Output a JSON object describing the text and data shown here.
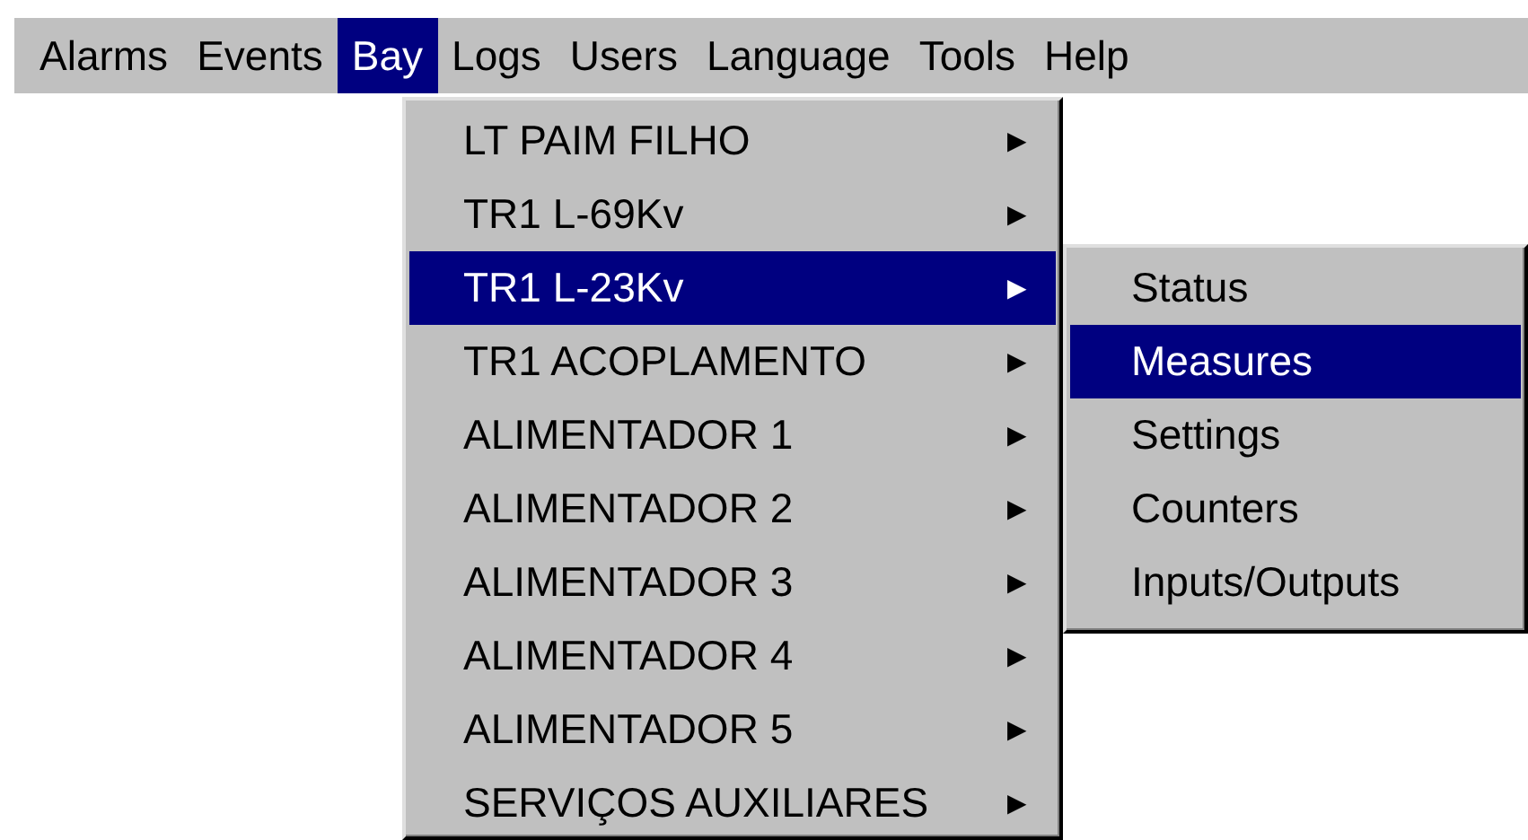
{
  "menubar": [
    {
      "label": "Alarms",
      "selected": false
    },
    {
      "label": "Events",
      "selected": false
    },
    {
      "label": "Bay",
      "selected": true
    },
    {
      "label": "Logs",
      "selected": false
    },
    {
      "label": "Users",
      "selected": false
    },
    {
      "label": "Language",
      "selected": false
    },
    {
      "label": "Tools",
      "selected": false
    },
    {
      "label": "Help",
      "selected": false
    }
  ],
  "bay_menu": {
    "items": [
      {
        "label": "LT PAIM FILHO",
        "selected": false,
        "submenu_arrow": "▶"
      },
      {
        "label": "TR1 L-69Kv",
        "selected": false,
        "submenu_arrow": "▶"
      },
      {
        "label": "TR1 L-23Kv",
        "selected": true,
        "submenu_arrow": "▶"
      },
      {
        "label": "TR1 ACOPLAMENTO",
        "selected": false,
        "submenu_arrow": "▶"
      },
      {
        "label": "ALIMENTADOR 1",
        "selected": false,
        "submenu_arrow": "▶"
      },
      {
        "label": "ALIMENTADOR 2",
        "selected": false,
        "submenu_arrow": "▶"
      },
      {
        "label": "ALIMENTADOR 3",
        "selected": false,
        "submenu_arrow": "▶"
      },
      {
        "label": "ALIMENTADOR 4",
        "selected": false,
        "submenu_arrow": "▶"
      },
      {
        "label": "ALIMENTADOR 5",
        "selected": false,
        "submenu_arrow": "▶"
      },
      {
        "label": "SERVIÇOS AUXILIARES",
        "selected": false,
        "submenu_arrow": "▶"
      }
    ]
  },
  "submenu": {
    "items": [
      {
        "label": "Status",
        "selected": false
      },
      {
        "label": "Measures",
        "selected": true
      },
      {
        "label": "Settings",
        "selected": false
      },
      {
        "label": "Counters",
        "selected": false
      },
      {
        "label": "Inputs/Outputs",
        "selected": false
      }
    ]
  }
}
